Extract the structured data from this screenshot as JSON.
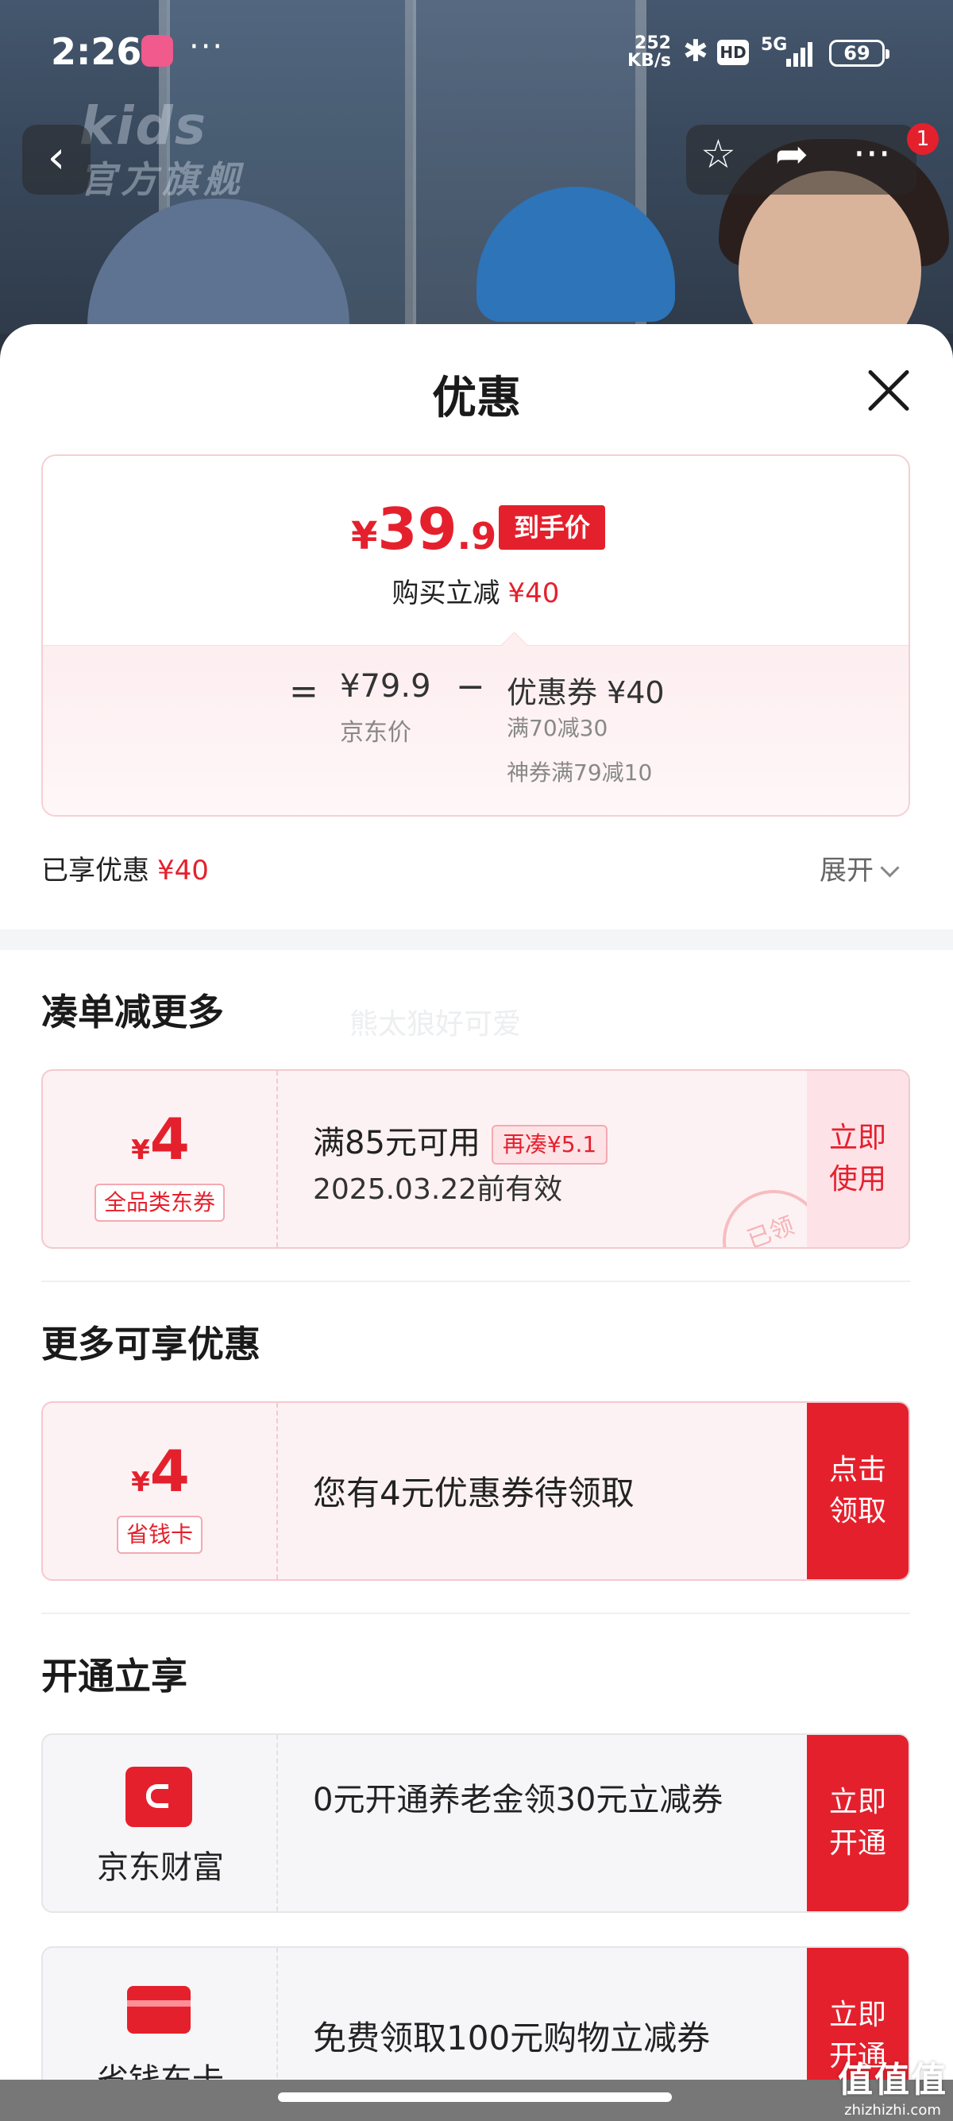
{
  "status_bar": {
    "time": "2:26",
    "more": "···",
    "speed_value": "252",
    "speed_unit": "KB/s",
    "hd": "HD",
    "network": "5G",
    "battery": "69"
  },
  "hero": {
    "logo": "kids",
    "logo_sub": "官方旗舰"
  },
  "nav": {
    "back_icon": "‹",
    "cart_badge": "1"
  },
  "sheet": {
    "title": "优惠",
    "price": {
      "yen": "¥",
      "integer": "39",
      "decimal": ".9",
      "tag": "到手价",
      "instant_label": "购买立减",
      "instant_amount": "¥40"
    },
    "breakdown": {
      "equals": "=",
      "jd_price": "¥79.9",
      "jd_label": "京东价",
      "minus": "−",
      "coupon_summary": "优惠券 ¥40",
      "condition_1": "满70减30",
      "condition_2": "神券满79减10"
    },
    "enjoyed_label": "已享优惠",
    "enjoyed_amount": "¥40",
    "expand_label": "展开"
  },
  "section_1": {
    "title": "凑单减更多",
    "watermark": "熊太狼好可爱",
    "coupon": {
      "yen": "¥",
      "amount": "4",
      "type": "全品类东券",
      "desc": "满85元可用",
      "extra": "再凑¥5.1",
      "validity": "2025.03.22前有效",
      "action": "立即使用",
      "stamp": "已领"
    }
  },
  "section_2": {
    "title": "更多可享优惠",
    "coupon": {
      "yen": "¥",
      "amount": "4",
      "type": "省钱卡",
      "desc": "您有4元优惠券待领取",
      "action": "点击领取"
    }
  },
  "section_3": {
    "title": "开通立享",
    "items": [
      {
        "brand": "京东财富",
        "desc": "0元开通养老金领30元立减券",
        "action": "立即开通"
      },
      {
        "brand": "省钱东卡",
        "desc": "免费领取100元购物立减券",
        "action": "立即开通"
      }
    ]
  },
  "watermark_site": {
    "big": "值值值",
    "small": "zhizhizhi.com"
  },
  "colors": {
    "accent": "#e5202d",
    "card_border": "#f3c9ce"
  }
}
